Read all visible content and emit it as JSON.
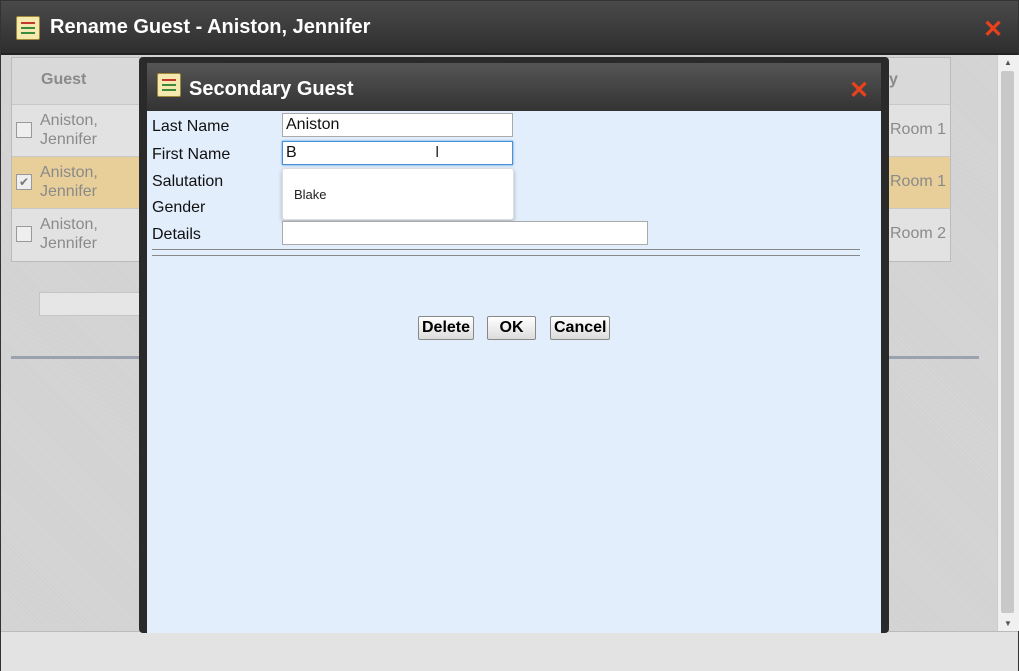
{
  "window": {
    "title": "Rename Guest - Aniston, Jennifer",
    "icon": "form-icon",
    "close_icon": "close-x-icon"
  },
  "background_table": {
    "header_guest": "Guest",
    "header_partial": "y",
    "rows": [
      {
        "name": "Aniston,\nJennifer",
        "room": "Room 1",
        "checked": false
      },
      {
        "name": "Aniston,\nJennifer",
        "room": "Room 1",
        "checked": true
      },
      {
        "name": "Aniston,\nJennifer",
        "room": "Room 2",
        "checked": false
      }
    ]
  },
  "dialog": {
    "title": "Secondary Guest",
    "fields": {
      "last_name_label": "Last Name",
      "last_name_value": "Aniston",
      "first_name_label": "First Name",
      "first_name_value": "B",
      "salutation_label": "Salutation",
      "gender_label": "Gender",
      "details_label": "Details",
      "details_value": ""
    },
    "autocomplete": {
      "option": "Blake"
    },
    "buttons": {
      "delete": "Delete",
      "ok": "OK",
      "cancel": "Cancel"
    }
  },
  "colors": {
    "close": "#e8411c",
    "selected_row": "#e8cf9a",
    "dialog_bg": "#e2eefc"
  }
}
